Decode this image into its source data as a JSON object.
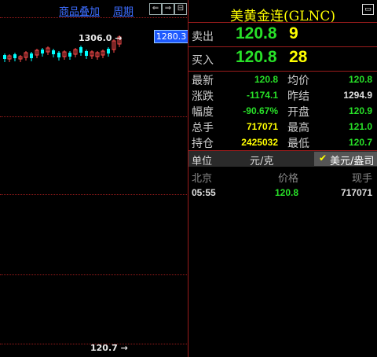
{
  "toolbar": {
    "overlay_label": "商品叠加",
    "period_label": "周期",
    "btn_prev": "⇐",
    "btn_next": "⇒",
    "btn_panel": "⊟"
  },
  "chart": {
    "high_label": "1306.0",
    "low_label": "120.7",
    "right_axis_value": "1280.3",
    "up_color": "#ff4b4b",
    "down_color": "#00ffff"
  },
  "quote": {
    "title": "美黄金连(GLNC)",
    "sell": {
      "label": "卖出",
      "price": "120.8",
      "volume": "9"
    },
    "buy": {
      "label": "买入",
      "price": "120.8",
      "volume": "28"
    },
    "stats": [
      {
        "label": "最新",
        "value": "120.8",
        "color": "#28e028"
      },
      {
        "label": "均价",
        "value": "120.8",
        "color": "#28e028"
      },
      {
        "label": "涨跌",
        "value": "-1174.1",
        "color": "#28e028"
      },
      {
        "label": "昨结",
        "value": "1294.9",
        "color": "#e0e0e0"
      },
      {
        "label": "幅度",
        "value": "-90.67%",
        "color": "#28e028"
      },
      {
        "label": "开盘",
        "value": "120.9",
        "color": "#28e028"
      },
      {
        "label": "总手",
        "value": "717071",
        "color": "#ffff00"
      },
      {
        "label": "最高",
        "value": "121.0",
        "color": "#28e028"
      },
      {
        "label": "持仓",
        "value": "2425032",
        "color": "#ffff00"
      },
      {
        "label": "最低",
        "value": "120.7",
        "color": "#28e028"
      }
    ],
    "unit_label": "单位",
    "unit_value": "元/克",
    "unit_option": "美元/盎司",
    "ticks_header": {
      "location": "北京",
      "price": "价格",
      "volume": "现手"
    },
    "ticks": [
      {
        "time": "05:55",
        "price": "120.8",
        "volume": "717071"
      }
    ]
  }
}
